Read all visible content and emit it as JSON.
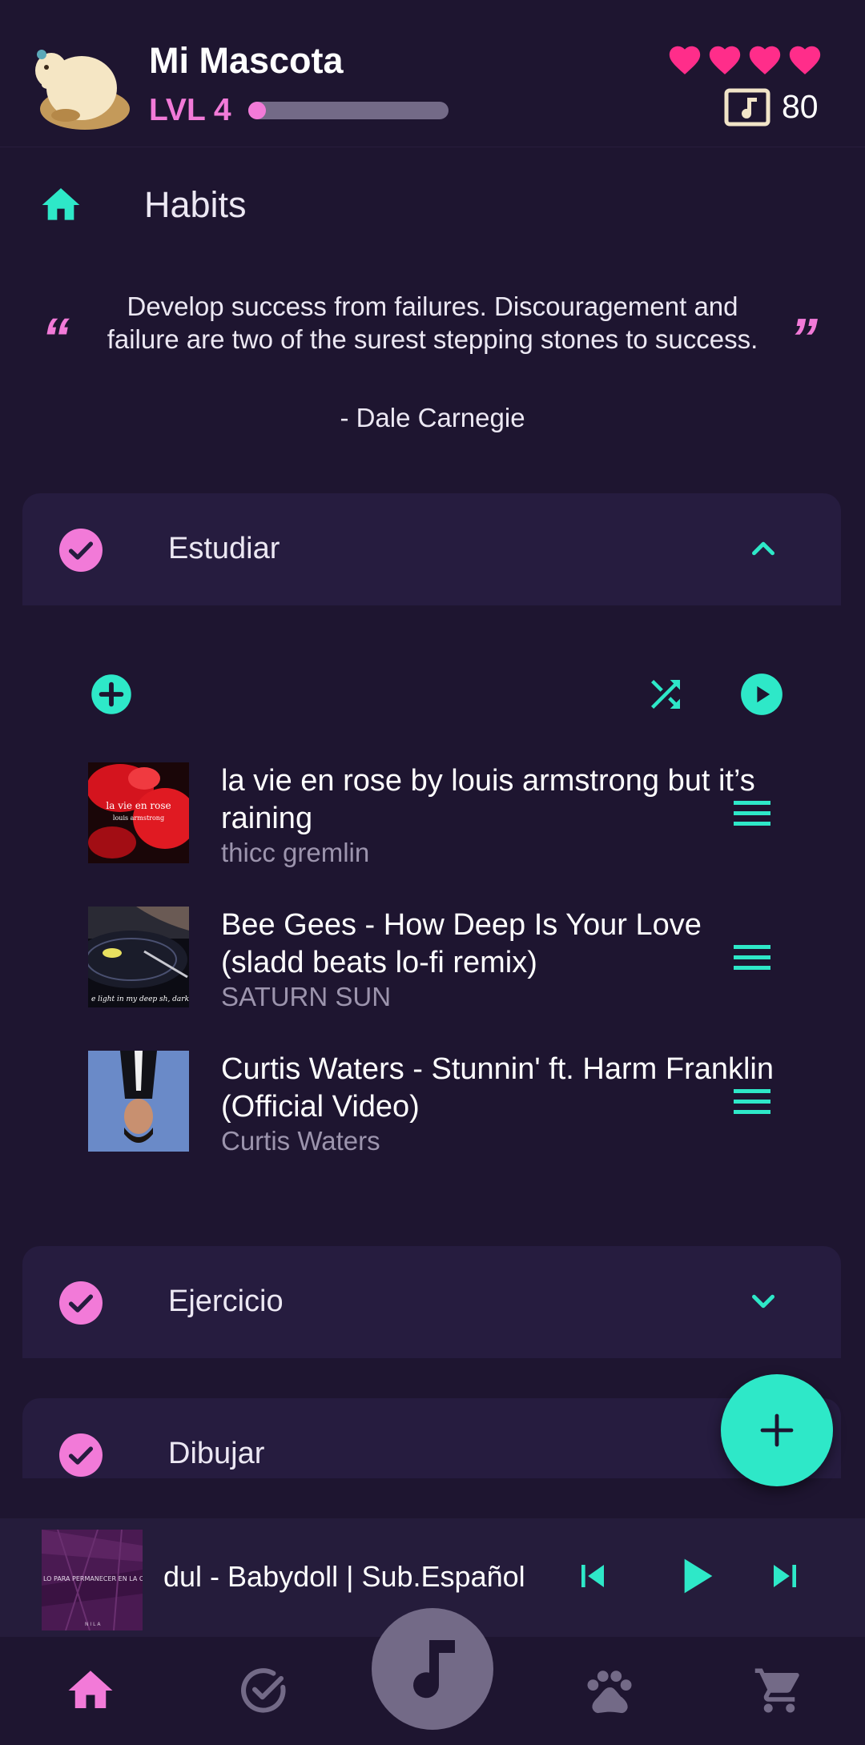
{
  "header": {
    "pet_name": "Mi Mascota",
    "level_label": "LVL 4",
    "xp_fraction": 0.08,
    "hearts": 4,
    "coins": "80"
  },
  "page": {
    "title": "Habits"
  },
  "quote": {
    "open_mark": "“",
    "close_mark": "”",
    "text": "Develop success from failures. Discouragement and failure are two of the surest stepping stones to success.",
    "author": "- Dale Carnegie"
  },
  "habits": [
    {
      "name": "Estudiar",
      "expanded": true
    },
    {
      "name": "Ejercicio",
      "expanded": false
    },
    {
      "name": "Dibujar",
      "expanded": false
    }
  ],
  "playlist": {
    "tracks": [
      {
        "title": "la vie en rose by louis armstrong but it’s raining",
        "artist": "thicc gremlin",
        "thumb_title": "la vie en rose",
        "thumb_subtitle": "louis armstrong"
      },
      {
        "title": "Bee Gees - How Deep Is Your Love (sladd beats lo-fi remix)",
        "artist": "SATURN SUN",
        "thumb_caption": "e light in my deep sh, dark"
      },
      {
        "title": "Curtis Waters - Stunnin' ft. Harm Franklin (Official Video)",
        "artist": "Curtis Waters"
      }
    ]
  },
  "now_playing": {
    "title": "dul  - Babydoll | Sub.Español",
    "thumb_caption": "LO PARA PERMANECER EN LA C",
    "thumb_label": "N I L A"
  },
  "icons": {
    "home": "home-icon",
    "habits": "check-circle-icon",
    "music": "music-note-icon",
    "pet": "paw-icon",
    "shop": "cart-icon"
  },
  "colors": {
    "background": "#1e1530",
    "card": "#261c3f",
    "accent_teal": "#2ee8c8",
    "accent_pink": "#f27ad8",
    "heart": "#ff2d8a",
    "muted": "#736a87"
  }
}
